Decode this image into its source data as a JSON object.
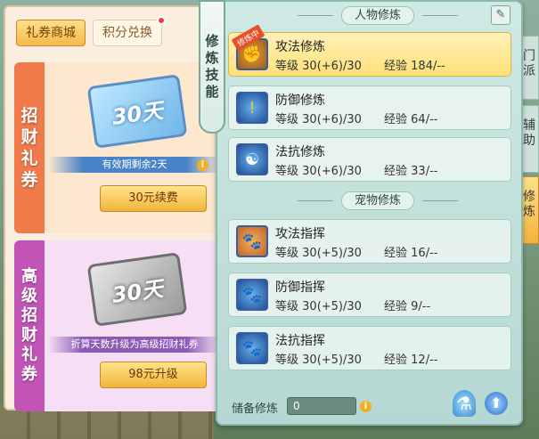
{
  "shop": {
    "tabs": [
      {
        "label": "礼券商城",
        "active": true
      },
      {
        "label": "积分兑换",
        "active": false,
        "has_dot": true
      }
    ],
    "cards": [
      {
        "vertical_label": [
          "招",
          "财",
          "礼",
          "券"
        ],
        "ticket_text": "30天",
        "info": "有效期剩余2天",
        "button": "30元续费"
      },
      {
        "vertical_label": [
          "高",
          "级",
          "招",
          "财",
          "礼",
          "券"
        ],
        "ticket_text": "30天",
        "info": "折算天数升级为高级招财礼券",
        "button": "98元升级"
      }
    ]
  },
  "side_label": [
    "修",
    "炼",
    "技",
    "能"
  ],
  "right_tabs": [
    {
      "label": [
        "门",
        "派"
      ]
    },
    {
      "label": [
        "辅",
        "助"
      ]
    },
    {
      "label": [
        "修",
        "炼"
      ],
      "active": true
    }
  ],
  "panel": {
    "section1_title": "人物修炼",
    "section2_title": "宠物修炼",
    "level_prefix": "等级",
    "exp_prefix": "经验",
    "rows": [
      {
        "name": "攻法修炼",
        "level": "30(+6)/30",
        "exp": "184/--",
        "badge": "修炼中",
        "selected": true,
        "icon": "fist-icon"
      },
      {
        "name": "防御修炼",
        "level": "30(+6)/30",
        "exp": "64/--",
        "icon": "shield-icon"
      },
      {
        "name": "法抗修炼",
        "level": "30(+6)/30",
        "exp": "33/--",
        "icon": "yin-yang-icon"
      },
      {
        "name": "攻法指挥",
        "level": "30(+5)/30",
        "exp": "16/--",
        "icon": "paw-attack-icon"
      },
      {
        "name": "防御指挥",
        "level": "30(+5)/30",
        "exp": "9/--",
        "icon": "paw-defense-icon"
      },
      {
        "name": "法抗指挥",
        "level": "30(+5)/30",
        "exp": "12/--",
        "icon": "paw-resist-icon"
      }
    ],
    "reserve_label": "储备修炼",
    "reserve_value": "0"
  }
}
